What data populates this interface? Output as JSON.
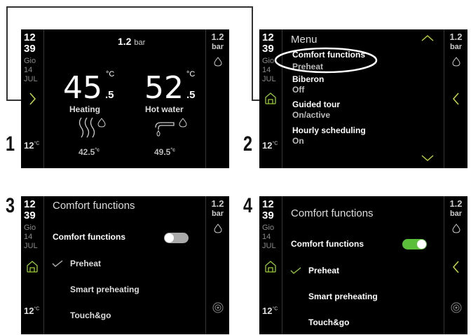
{
  "common": {
    "hour": "12",
    "minute": "39",
    "day_name": "Gio",
    "day_num": "14",
    "month": "JUL",
    "outdoor_temp": "12",
    "temp_unit": "°C",
    "pressure_val": "1.2",
    "pressure_unit": "bar"
  },
  "step_numbers": [
    "1",
    "2",
    "3",
    "4"
  ],
  "screen1": {
    "pressure_val": "1.2",
    "pressure_unit": "bar",
    "heating": {
      "value": "45",
      "decimal": ".5",
      "unit": "°C",
      "label": "Heating",
      "setpoint": "42.5",
      "setpoint_unit": "°c"
    },
    "hot_water": {
      "value": "52",
      "decimal": ".5",
      "unit": "°C",
      "label": "Hot water",
      "setpoint": "49.5",
      "setpoint_unit": "°c"
    }
  },
  "screen2": {
    "title": "Menu",
    "items": [
      {
        "label": "Comfort functions",
        "value": "Preheat"
      },
      {
        "label": "Biberon",
        "value": "Off"
      },
      {
        "label": "Guided tour",
        "value": "On/active"
      },
      {
        "label": "Hourly scheduling",
        "value": "On"
      }
    ]
  },
  "screen3": {
    "title": "Comfort functions",
    "toggle_label": "Comfort functions",
    "toggle_on": false,
    "options": [
      {
        "label": "Preheat",
        "checked": true
      },
      {
        "label": "Smart preheating",
        "checked": false
      },
      {
        "label": "Touch&go",
        "checked": false
      }
    ]
  },
  "screen4": {
    "title": "Comfort functions",
    "toggle_label": "Comfort functions",
    "toggle_on": true,
    "options": [
      {
        "label": "Preheat",
        "checked": true
      },
      {
        "label": "Smart preheating",
        "checked": false
      },
      {
        "label": "Touch&go",
        "checked": false
      }
    ]
  },
  "colors": {
    "screen_bg": "#000000",
    "toggle_on": "#5bbf3a",
    "toggle_off": "#aaaaaa",
    "home_icon": "#9acd32",
    "chevron": "#c8dc32"
  },
  "icons": [
    "chevron-right-icon",
    "home-icon",
    "flame-icon",
    "chevron-left-icon",
    "chevron-up-icon",
    "chevron-down-icon",
    "radiator-waves-icon",
    "tap-icon",
    "check-icon",
    "spiral-icon"
  ]
}
